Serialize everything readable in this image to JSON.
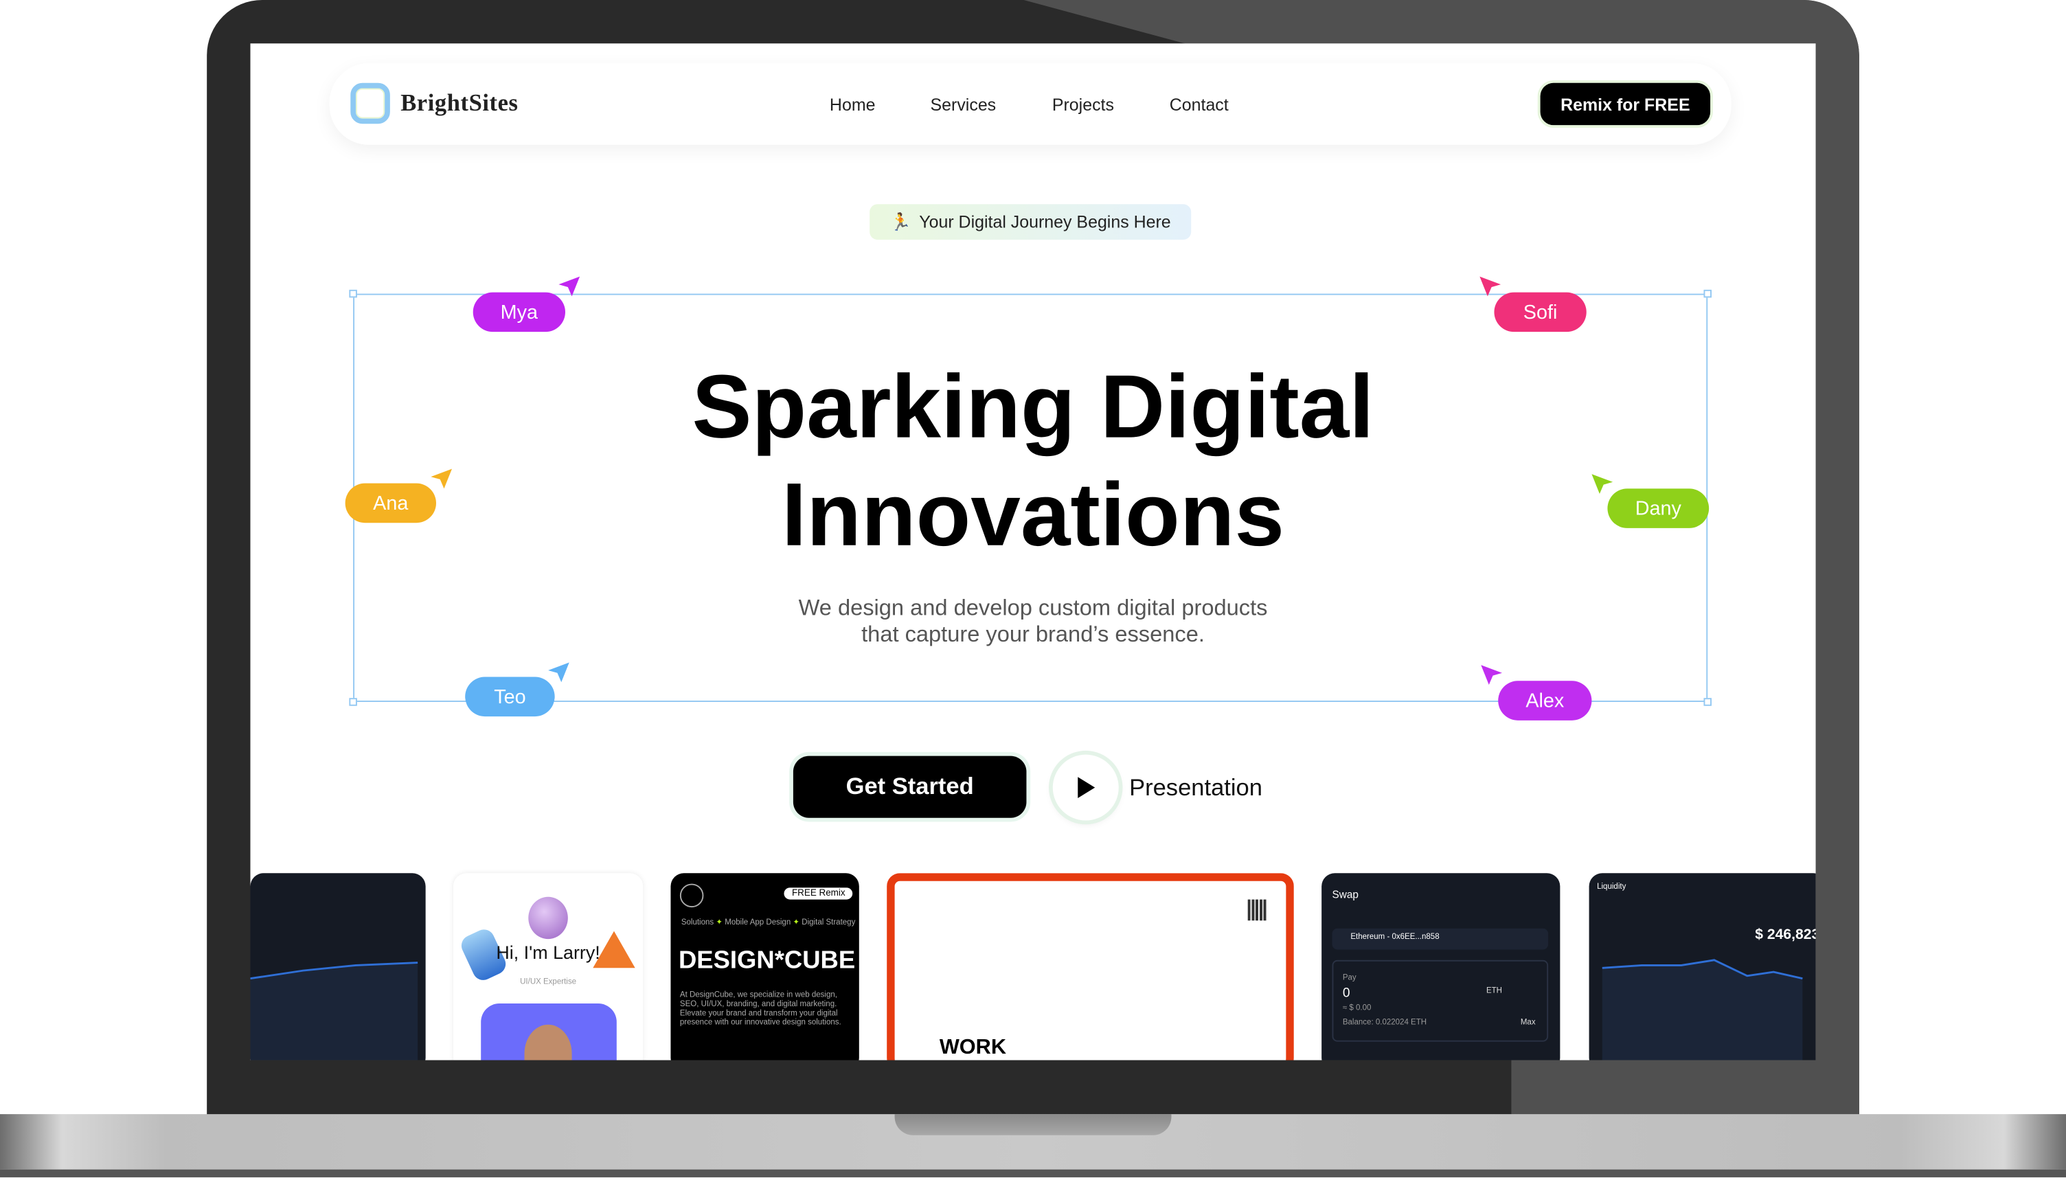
{
  "brand": {
    "name": "BrightSites"
  },
  "nav": {
    "links": [
      "Home",
      "Services",
      "Projects",
      "Contact"
    ],
    "cta": "Remix for FREE"
  },
  "badge": {
    "icon": "running-figure-icon",
    "text": "Your Digital Journey Begins Here"
  },
  "hero": {
    "title_line1": "Sparking Digital",
    "title_line2": "Innovations",
    "subtitle_line1": "We design and develop custom digital products",
    "subtitle_line2": "that capture your brand’s essence."
  },
  "cursors": [
    {
      "name": "Mya",
      "color": "#c026f0"
    },
    {
      "name": "Sofi",
      "color": "#f0307a"
    },
    {
      "name": "Ana",
      "color": "#f5b222"
    },
    {
      "name": "Dany",
      "color": "#8fd11a"
    },
    {
      "name": "Teo",
      "color": "#5fb2f5"
    },
    {
      "name": "Alex",
      "color": "#c02ef0"
    }
  ],
  "actions": {
    "primary": "Get Started",
    "secondary": "Presentation"
  },
  "showcase": {
    "card2": {
      "title": "Hi, I'm Larry!",
      "subtitle": "UI/UX Expertise"
    },
    "card3": {
      "badge": "FREE Remix",
      "tags": [
        "Solutions",
        "Mobile App Design",
        "Digital Strategy"
      ],
      "title": "DESIGN*CUBE",
      "body": "At DesignCube, we specialize in web design, SEO, UI/UX, branding, and digital marketing. Elevate your brand and transform your digital presence with our innovative design solutions."
    },
    "card4": {
      "title": "WORK"
    },
    "card5": {
      "title": "Swap",
      "network": "Ethereum - 0x6EE...n858",
      "pay_label": "Pay",
      "pay_value": "0",
      "usd": "≈ $ 0.00",
      "token": "ETH",
      "balance": "Balance: 0.022024 ETH",
      "max": "Max"
    },
    "card6": {
      "title": "Liquidity",
      "value": "$ 246,823"
    }
  },
  "colors": {
    "accent_border": "#93c8f2",
    "card_orange": "#e63b10",
    "dark_card": "#151a24"
  }
}
